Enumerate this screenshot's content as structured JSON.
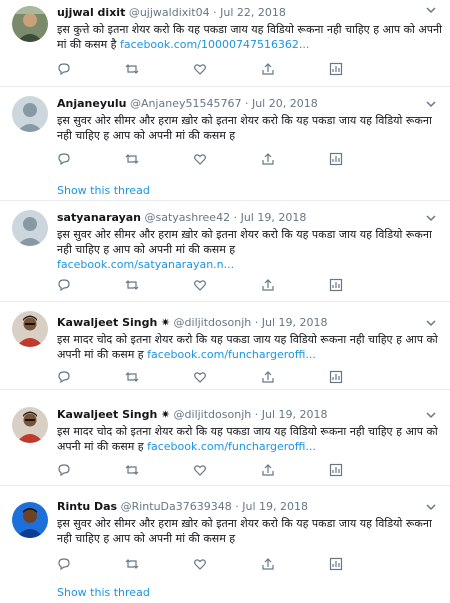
{
  "tweets": [
    {
      "name": "ujjwal dixit",
      "verified": false,
      "handle": "@ujjwaldixit04",
      "date": "Jul 22, 2018",
      "text": "इस कुत्ते को इतना शेयर करो कि यह पकडा जाय यह विडियो रूकना नही चाहिए ह आप को अपनी मां की कसम है ",
      "link": "facebook.com/10000747516362...",
      "show_thread": ""
    },
    {
      "name": "Anjaneyulu",
      "verified": false,
      "handle": "@Anjaney51545767",
      "date": "Jul 20, 2018",
      "text": "इस सुवर ओर सीमर और हराम ख़ोर को इतना शेयर करो कि यह पकडा जाय यह विडियो रूकना नही चाहिए ह आप को अपनी मां की कसम ह",
      "link": "",
      "show_thread": "Show this thread"
    },
    {
      "name": "satyanarayan",
      "verified": false,
      "handle": "@satyashree42",
      "date": "Jul 19, 2018",
      "text": "इस सुवर ओर सीमर और हराम ख़ोर को इतना शेयर करो कि यह पकडा जाय यह विडियो रूकना नही चाहिए ह आप को अपनी मां की कसम ह",
      "link": "facebook.com/satyanarayan.n...",
      "show_thread": ""
    },
    {
      "name": "Kawaljeet Singh",
      "verified": true,
      "handle": "@diljitdosonjh",
      "date": "Jul 19, 2018",
      "text": "इस मादर चोद को इतना शेयर करो कि यह पकडा जाय यह विडियो रूकना नही चाहिए ह आप को अपनी मां की कसम ह ",
      "link": "facebook.com/funchargeroffi...",
      "show_thread": ""
    },
    {
      "name": "Kawaljeet Singh",
      "verified": true,
      "handle": "@diljitdosonjh",
      "date": "Jul 19, 2018",
      "text": "इस मादर चोद को इतना शेयर करो कि यह पकडा जाय यह विडियो रूकना नही चाहिए ह आप को अपनी मां की कसम ह ",
      "link": "facebook.com/funchargeroffi...",
      "show_thread": ""
    },
    {
      "name": "Rintu Das",
      "verified": false,
      "handle": "@RintuDa37639348",
      "date": "Jul 19, 2018",
      "text": "इस सुवर ओर सीमर और हराम ख़ोर को इतना शेयर करो कि यह पकडा जाय यह विडियो रूकना नही चाहिए ह आप को अपनी मां की कसम ह",
      "link": "",
      "show_thread": "Show this thread"
    }
  ],
  "separator": "·",
  "verified_mark": "✷",
  "icons": [
    "reply-icon",
    "retweet-icon",
    "like-icon",
    "share-icon",
    "analytics-icon",
    "more-chevron-icon"
  ],
  "colors": {
    "link": "#1b95e0",
    "muted": "#657786",
    "text": "#14171a",
    "border": "#e6ecf0"
  }
}
